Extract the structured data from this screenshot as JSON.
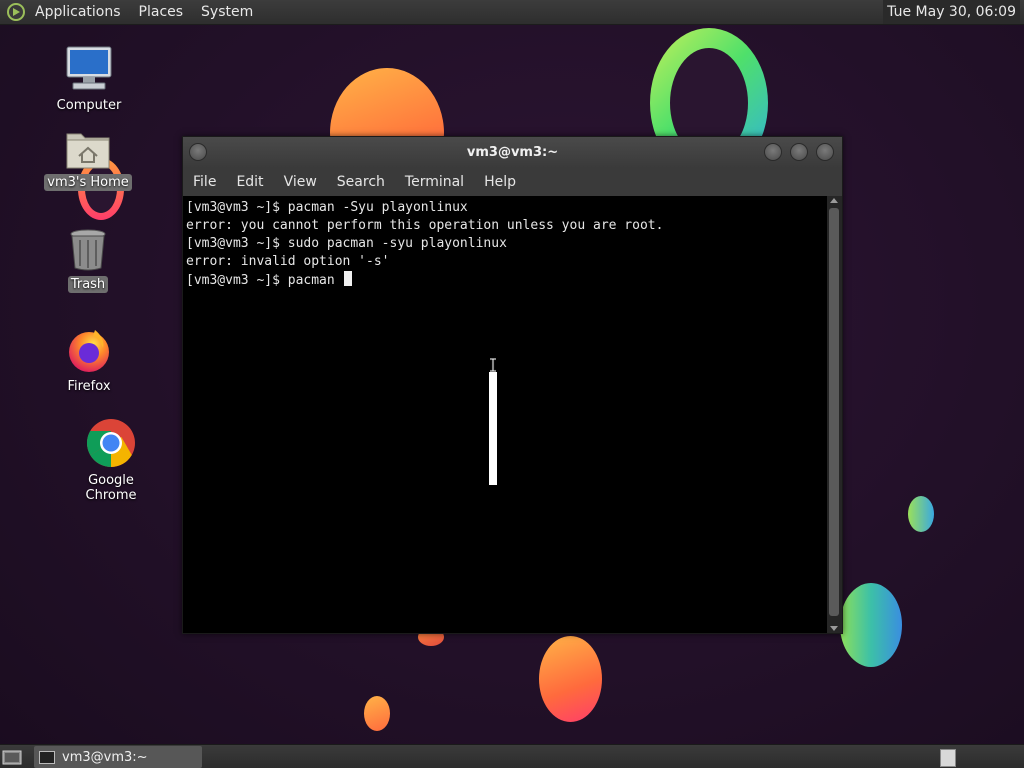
{
  "top_panel": {
    "menus": [
      "Applications",
      "Places",
      "System"
    ],
    "clock": "Tue May 30, 06:09"
  },
  "desktop_icons": {
    "computer": "Computer",
    "home": "vm3's Home",
    "trash": "Trash",
    "firefox": "Firefox",
    "chrome": "Google Chrome"
  },
  "terminal": {
    "title": "vm3@vm3:~",
    "menus": [
      "File",
      "Edit",
      "View",
      "Search",
      "Terminal",
      "Help"
    ],
    "lines": [
      "[vm3@vm3 ~]$ pacman -Syu playonlinux",
      "error: you cannot perform this operation unless you are root.",
      "[vm3@vm3 ~]$ sudo pacman -syu playonlinux",
      "error: invalid option '-s'",
      "[vm3@vm3 ~]$ pacman "
    ]
  },
  "taskbar": {
    "task_label": "vm3@vm3:~"
  },
  "icons": {
    "distro_logo": "distro-logo-icon",
    "computer": "monitor-icon",
    "home": "home-folder-icon",
    "trash": "trash-icon",
    "firefox": "firefox-icon",
    "chrome": "chrome-icon",
    "show_desktop": "show-desktop-icon",
    "terminal_task": "terminal-icon"
  },
  "colors": {
    "panel": "#3a3a3a",
    "terminal_bg": "#000000",
    "terminal_fg": "#e6e6e6",
    "icon_selection": "#6e6e6e"
  }
}
